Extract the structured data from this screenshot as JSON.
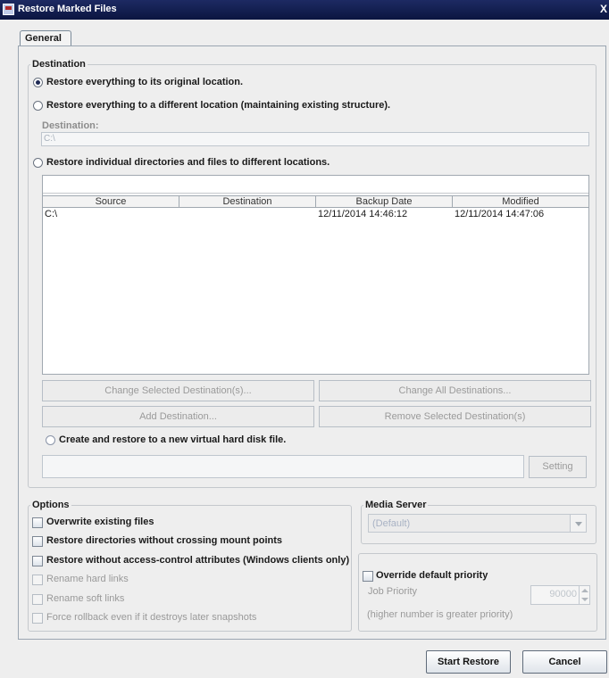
{
  "window": {
    "title": "Restore Marked Files",
    "close_glyph": "X"
  },
  "tabs": [
    {
      "label": "General"
    }
  ],
  "destination": {
    "group_title": "Destination",
    "radio_original": "Restore everything to its original location.",
    "radio_different": "Restore everything to a different location (maintaining existing structure).",
    "destination_label": "Destination:",
    "destination_value": "C:\\",
    "radio_individual": "Restore individual directories and files to different locations.",
    "table": {
      "columns": [
        "Source",
        "Destination",
        "Backup Date",
        "Modified"
      ],
      "rows": [
        {
          "source": "C:\\",
          "destination": "",
          "backup_date": "12/11/2014 14:46:12",
          "modified": "12/11/2014 14:47:06"
        }
      ]
    },
    "buttons": {
      "change_selected": "Change Selected Destination(s)...",
      "change_all": "Change All Destinations...",
      "add": "Add Destination...",
      "remove": "Remove Selected Destination(s)"
    },
    "radio_vhd": "Create and restore to a new virtual hard disk file.",
    "vhd_path": "",
    "setting_button": "Setting"
  },
  "options": {
    "group_title": "Options",
    "items": [
      {
        "label": "Overwrite existing files",
        "enabled": true
      },
      {
        "label": "Restore directories without crossing mount points",
        "enabled": true
      },
      {
        "label": "Restore without access-control attributes (Windows clients only)",
        "enabled": true
      },
      {
        "label": "Rename hard links",
        "enabled": false
      },
      {
        "label": "Rename soft links",
        "enabled": false
      },
      {
        "label": "Force rollback even if it destroys later snapshots",
        "enabled": false
      }
    ]
  },
  "media_server": {
    "group_title": "Media Server",
    "selected": "(Default)"
  },
  "priority": {
    "override_label": "Override default priority",
    "job_priority_label": "Job Priority",
    "job_priority_value": "90000",
    "hint": "(higher number is greater priority)"
  },
  "footer": {
    "start_restore": "Start Restore",
    "cancel": "Cancel"
  }
}
